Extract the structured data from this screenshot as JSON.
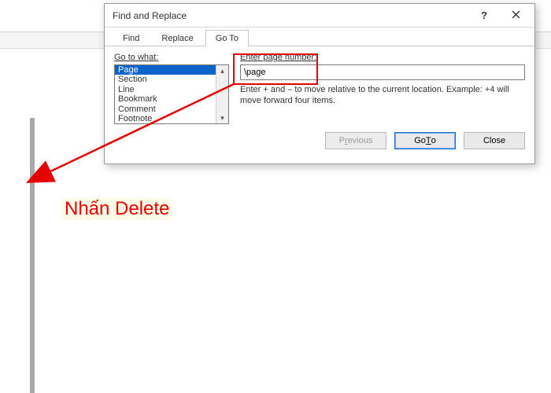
{
  "dialog": {
    "title": "Find and Replace",
    "help_tooltip": "?",
    "tabs": {
      "find": "Find",
      "replace": "Replace",
      "goto": "Go To"
    },
    "goto_what_label": "Go to what:",
    "options": [
      "Page",
      "Section",
      "Line",
      "Bookmark",
      "Comment",
      "Footnote"
    ],
    "selected_index": 0,
    "enter_label": "Enter page number:",
    "enter_value": "\\page",
    "hint": "Enter + and – to move relative to the current location. Example: +4 will move forward four items.",
    "buttons": {
      "previous_pre": "P",
      "previous_ul": "r",
      "previous_post": "evious",
      "goto_pre": "Go ",
      "goto_ul": "T",
      "goto_post": "o",
      "close": "Close"
    }
  },
  "annotation": {
    "text": "Nhấn Delete"
  }
}
